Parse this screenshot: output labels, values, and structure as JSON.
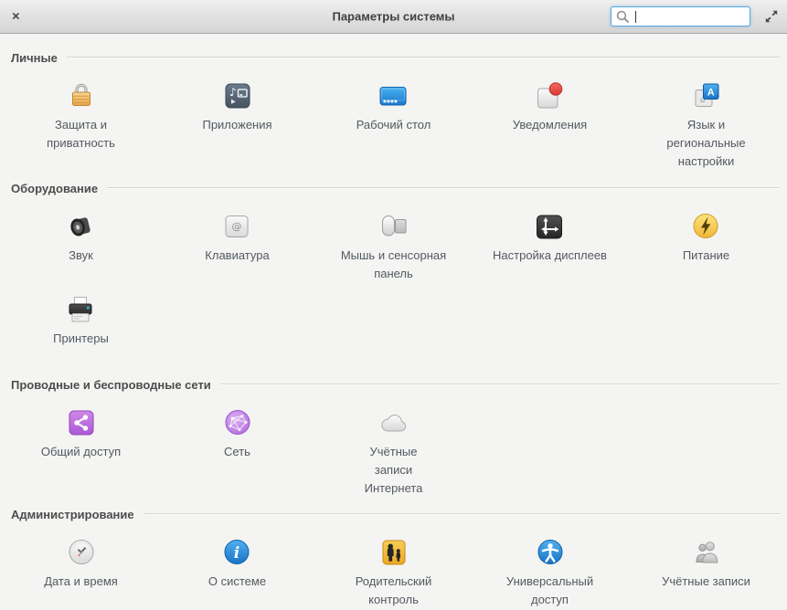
{
  "window": {
    "title": "Параметры системы",
    "close_glyph": "×"
  },
  "search": {
    "placeholder": "",
    "value": ""
  },
  "accent_colors": {
    "search_focus_border": "#56a7e2",
    "headerbar_top": "#efefef",
    "headerbar_bottom": "#d4d4d4",
    "background": "#f4f4f2"
  },
  "sections": [
    {
      "label": "Личные",
      "items": [
        {
          "label": "Защита и приватность",
          "icon": "lock-icon"
        },
        {
          "label": "Приложения",
          "icon": "applications-icon"
        },
        {
          "label": "Рабочий стол",
          "icon": "desktop-icon"
        },
        {
          "label": "Уведомления",
          "icon": "notifications-icon"
        },
        {
          "label": "Язык и региональные настройки",
          "icon": "language-icon"
        }
      ]
    },
    {
      "label": "Оборудование",
      "items": [
        {
          "label": "Звук",
          "icon": "speaker-icon"
        },
        {
          "label": "Клавиатура",
          "icon": "keyboard-icon"
        },
        {
          "label": "Мышь и сенсорная панель",
          "icon": "mouse-touchpad-icon"
        },
        {
          "label": "Настройка дисплеев",
          "icon": "display-icon"
        },
        {
          "label": "Питание",
          "icon": "power-icon"
        },
        {
          "label": "Принтеры",
          "icon": "printer-icon"
        }
      ]
    },
    {
      "label": "Проводные и беспроводные сети",
      "items": [
        {
          "label": "Общий доступ",
          "icon": "share-icon"
        },
        {
          "label": "Сеть",
          "icon": "network-icon"
        },
        {
          "label": "Учётные записи Интернета",
          "icon": "cloud-icon"
        }
      ]
    },
    {
      "label": "Администрирование",
      "items": [
        {
          "label": "Дата и время",
          "icon": "clock-icon"
        },
        {
          "label": "О системе",
          "icon": "info-icon"
        },
        {
          "label": "Родительский контроль",
          "icon": "parental-controls-icon"
        },
        {
          "label": "Универсальный доступ",
          "icon": "accessibility-icon"
        },
        {
          "label": "Учётные записи",
          "icon": "user-accounts-icon"
        }
      ]
    }
  ]
}
